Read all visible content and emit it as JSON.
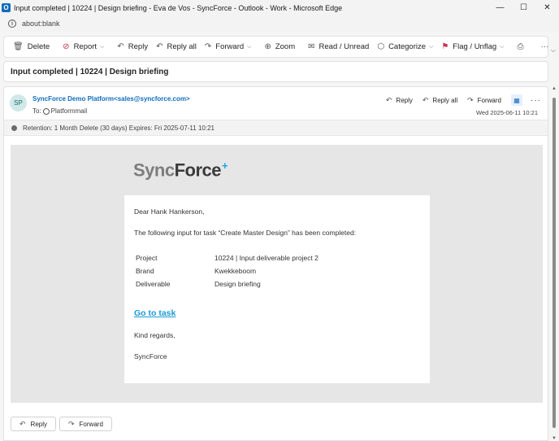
{
  "window": {
    "title": "Input completed | 10224 | Design briefing - Eva de Vos - SyncForce - Outlook - Work - Microsoft Edge",
    "app_icon": "O",
    "minimize": "—",
    "maximize": "☐",
    "close": "✕"
  },
  "address": {
    "url": "about:blank"
  },
  "toolbar": {
    "delete": "Delete",
    "report": "Report",
    "reply": "Reply",
    "reply_all": "Reply all",
    "forward": "Forward",
    "zoom": "Zoom",
    "read_unread": "Read / Unread",
    "categorize": "Categorize",
    "flag_unflag": "Flag / Unflag"
  },
  "subject": "Input completed | 10224 | Design briefing",
  "message": {
    "avatar_initials": "SP",
    "sender": "SyncForce Demo Platform<sales@syncforce.com>",
    "to_label": "To:",
    "to_recipient": "Platformmail",
    "date": "Wed 2025-06-11 10:21",
    "actions": {
      "reply": "Reply",
      "reply_all": "Reply all",
      "forward": "Forward"
    },
    "retention": "Retention: 1 Month Delete (30 days) Expires: Fri 2025-07-11 10:21"
  },
  "email": {
    "logo_sync": "Sync",
    "logo_force": "Force",
    "logo_plus": "+",
    "greeting": "Dear Hank Hankerson,",
    "intro": "The following input for task “Create Master Design” has been completed:",
    "details": [
      {
        "label": "Project",
        "value": "10224 | Input deliverable project 2"
      },
      {
        "label": "Brand",
        "value": "Kwekkeboom"
      },
      {
        "label": "Deliverable",
        "value": "Design briefing"
      }
    ],
    "goto_link": "Go to task",
    "regards": "Kind regards,",
    "signature": "SyncForce"
  },
  "footer": {
    "reply": "Reply",
    "forward": "Forward"
  },
  "colors": {
    "accent": "#0f6cbd",
    "link": "#1a9ad6",
    "logo_plus": "#1fa3e0"
  }
}
